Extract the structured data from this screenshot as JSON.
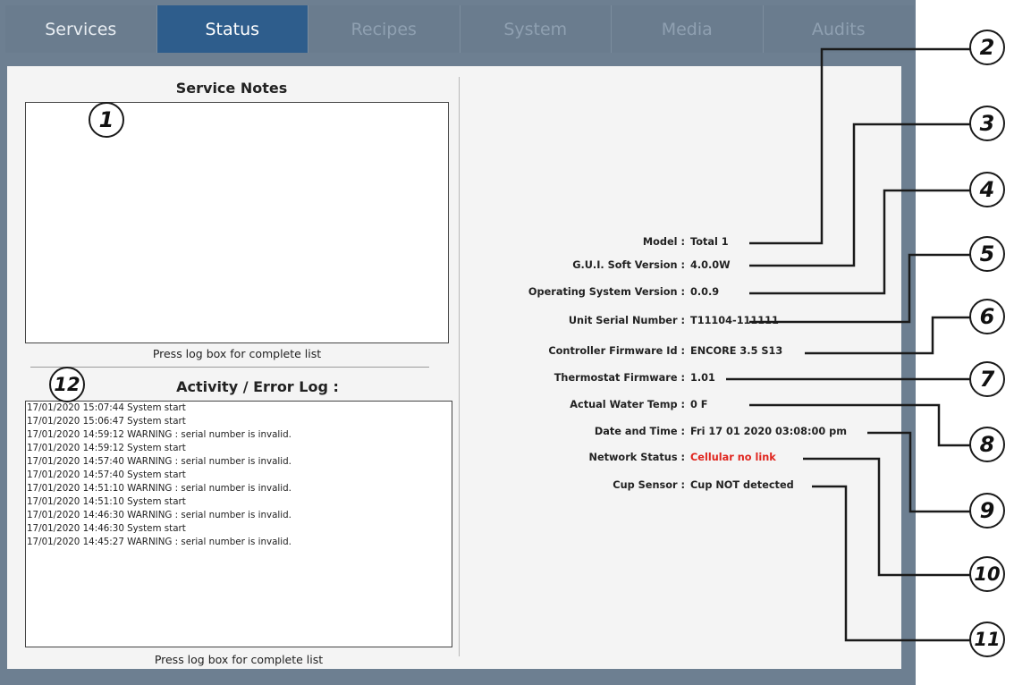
{
  "tabs": [
    {
      "label": "Services",
      "state": "enabled"
    },
    {
      "label": "Status",
      "state": "active"
    },
    {
      "label": "Recipes",
      "state": "disabled"
    },
    {
      "label": "System",
      "state": "disabled"
    },
    {
      "label": "Media",
      "state": "disabled"
    },
    {
      "label": "Audits",
      "state": "disabled"
    }
  ],
  "service_notes": {
    "title": "Service Notes",
    "hint": "Press log box for complete list"
  },
  "activity_log": {
    "title": "Activity / Error Log :",
    "hint": "Press log box for complete list",
    "entries": [
      "17/01/2020 15:07:44 System start",
      "17/01/2020 15:06:47 System start",
      "17/01/2020 14:59:12 WARNING : serial number is invalid.",
      "17/01/2020 14:59:12 System start",
      "17/01/2020 14:57:40 WARNING : serial number is invalid.",
      "17/01/2020 14:57:40 System start",
      "17/01/2020 14:51:10 WARNING : serial number is invalid.",
      "17/01/2020 14:51:10 System start",
      "17/01/2020 14:46:30 WARNING : serial number is invalid.",
      "17/01/2020 14:46:30 System start",
      "17/01/2020 14:45:27 WARNING : serial number is invalid."
    ]
  },
  "status_info": [
    {
      "label": "Model :",
      "value": "Total 1"
    },
    {
      "label": "G.U.I. Soft Version :",
      "value": "4.0.0W"
    },
    {
      "label": "Operating System Version :",
      "value": "0.0.9"
    },
    {
      "label": "Unit Serial Number :",
      "value": "T11104-111111"
    },
    {
      "label": "Controller Firmware Id :",
      "value": "ENCORE 3.5 S13"
    },
    {
      "label": "Thermostat Firmware :",
      "value": "1.01"
    },
    {
      "label": "Actual Water Temp :",
      "value": "0 F"
    },
    {
      "label": "Date and Time :",
      "value": "Fri 17 01 2020 03:08:00 pm"
    },
    {
      "label": "Network Status :",
      "value": "Cellular no link",
      "alert": true
    },
    {
      "label": "Cup Sensor :",
      "value": "Cup NOT detected"
    }
  ],
  "callouts": [
    "1",
    "2",
    "3",
    "4",
    "5",
    "6",
    "7",
    "8",
    "9",
    "10",
    "11",
    "12"
  ],
  "colors": {
    "frame": "#6d7f91",
    "active_tab": "#2e5d8c",
    "panel": "#f4f4f4",
    "alert_text": "#e0261f"
  }
}
